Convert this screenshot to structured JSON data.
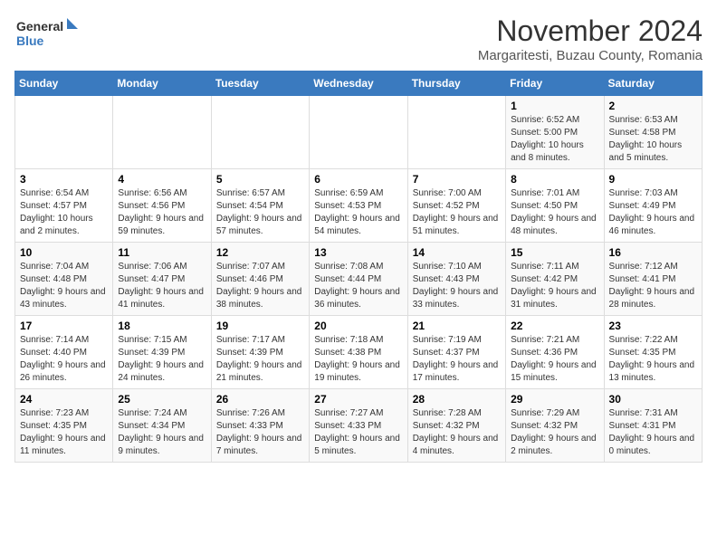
{
  "logo": {
    "line1": "General",
    "line2": "Blue"
  },
  "title": "November 2024",
  "location": "Margaritesti, Buzau County, Romania",
  "days_header": [
    "Sunday",
    "Monday",
    "Tuesday",
    "Wednesday",
    "Thursday",
    "Friday",
    "Saturday"
  ],
  "weeks": [
    [
      {
        "day": "",
        "info": ""
      },
      {
        "day": "",
        "info": ""
      },
      {
        "day": "",
        "info": ""
      },
      {
        "day": "",
        "info": ""
      },
      {
        "day": "",
        "info": ""
      },
      {
        "day": "1",
        "info": "Sunrise: 6:52 AM\nSunset: 5:00 PM\nDaylight: 10 hours and 8 minutes."
      },
      {
        "day": "2",
        "info": "Sunrise: 6:53 AM\nSunset: 4:58 PM\nDaylight: 10 hours and 5 minutes."
      }
    ],
    [
      {
        "day": "3",
        "info": "Sunrise: 6:54 AM\nSunset: 4:57 PM\nDaylight: 10 hours and 2 minutes."
      },
      {
        "day": "4",
        "info": "Sunrise: 6:56 AM\nSunset: 4:56 PM\nDaylight: 9 hours and 59 minutes."
      },
      {
        "day": "5",
        "info": "Sunrise: 6:57 AM\nSunset: 4:54 PM\nDaylight: 9 hours and 57 minutes."
      },
      {
        "day": "6",
        "info": "Sunrise: 6:59 AM\nSunset: 4:53 PM\nDaylight: 9 hours and 54 minutes."
      },
      {
        "day": "7",
        "info": "Sunrise: 7:00 AM\nSunset: 4:52 PM\nDaylight: 9 hours and 51 minutes."
      },
      {
        "day": "8",
        "info": "Sunrise: 7:01 AM\nSunset: 4:50 PM\nDaylight: 9 hours and 48 minutes."
      },
      {
        "day": "9",
        "info": "Sunrise: 7:03 AM\nSunset: 4:49 PM\nDaylight: 9 hours and 46 minutes."
      }
    ],
    [
      {
        "day": "10",
        "info": "Sunrise: 7:04 AM\nSunset: 4:48 PM\nDaylight: 9 hours and 43 minutes."
      },
      {
        "day": "11",
        "info": "Sunrise: 7:06 AM\nSunset: 4:47 PM\nDaylight: 9 hours and 41 minutes."
      },
      {
        "day": "12",
        "info": "Sunrise: 7:07 AM\nSunset: 4:46 PM\nDaylight: 9 hours and 38 minutes."
      },
      {
        "day": "13",
        "info": "Sunrise: 7:08 AM\nSunset: 4:44 PM\nDaylight: 9 hours and 36 minutes."
      },
      {
        "day": "14",
        "info": "Sunrise: 7:10 AM\nSunset: 4:43 PM\nDaylight: 9 hours and 33 minutes."
      },
      {
        "day": "15",
        "info": "Sunrise: 7:11 AM\nSunset: 4:42 PM\nDaylight: 9 hours and 31 minutes."
      },
      {
        "day": "16",
        "info": "Sunrise: 7:12 AM\nSunset: 4:41 PM\nDaylight: 9 hours and 28 minutes."
      }
    ],
    [
      {
        "day": "17",
        "info": "Sunrise: 7:14 AM\nSunset: 4:40 PM\nDaylight: 9 hours and 26 minutes."
      },
      {
        "day": "18",
        "info": "Sunrise: 7:15 AM\nSunset: 4:39 PM\nDaylight: 9 hours and 24 minutes."
      },
      {
        "day": "19",
        "info": "Sunrise: 7:17 AM\nSunset: 4:39 PM\nDaylight: 9 hours and 21 minutes."
      },
      {
        "day": "20",
        "info": "Sunrise: 7:18 AM\nSunset: 4:38 PM\nDaylight: 9 hours and 19 minutes."
      },
      {
        "day": "21",
        "info": "Sunrise: 7:19 AM\nSunset: 4:37 PM\nDaylight: 9 hours and 17 minutes."
      },
      {
        "day": "22",
        "info": "Sunrise: 7:21 AM\nSunset: 4:36 PM\nDaylight: 9 hours and 15 minutes."
      },
      {
        "day": "23",
        "info": "Sunrise: 7:22 AM\nSunset: 4:35 PM\nDaylight: 9 hours and 13 minutes."
      }
    ],
    [
      {
        "day": "24",
        "info": "Sunrise: 7:23 AM\nSunset: 4:35 PM\nDaylight: 9 hours and 11 minutes."
      },
      {
        "day": "25",
        "info": "Sunrise: 7:24 AM\nSunset: 4:34 PM\nDaylight: 9 hours and 9 minutes."
      },
      {
        "day": "26",
        "info": "Sunrise: 7:26 AM\nSunset: 4:33 PM\nDaylight: 9 hours and 7 minutes."
      },
      {
        "day": "27",
        "info": "Sunrise: 7:27 AM\nSunset: 4:33 PM\nDaylight: 9 hours and 5 minutes."
      },
      {
        "day": "28",
        "info": "Sunrise: 7:28 AM\nSunset: 4:32 PM\nDaylight: 9 hours and 4 minutes."
      },
      {
        "day": "29",
        "info": "Sunrise: 7:29 AM\nSunset: 4:32 PM\nDaylight: 9 hours and 2 minutes."
      },
      {
        "day": "30",
        "info": "Sunrise: 7:31 AM\nSunset: 4:31 PM\nDaylight: 9 hours and 0 minutes."
      }
    ]
  ]
}
